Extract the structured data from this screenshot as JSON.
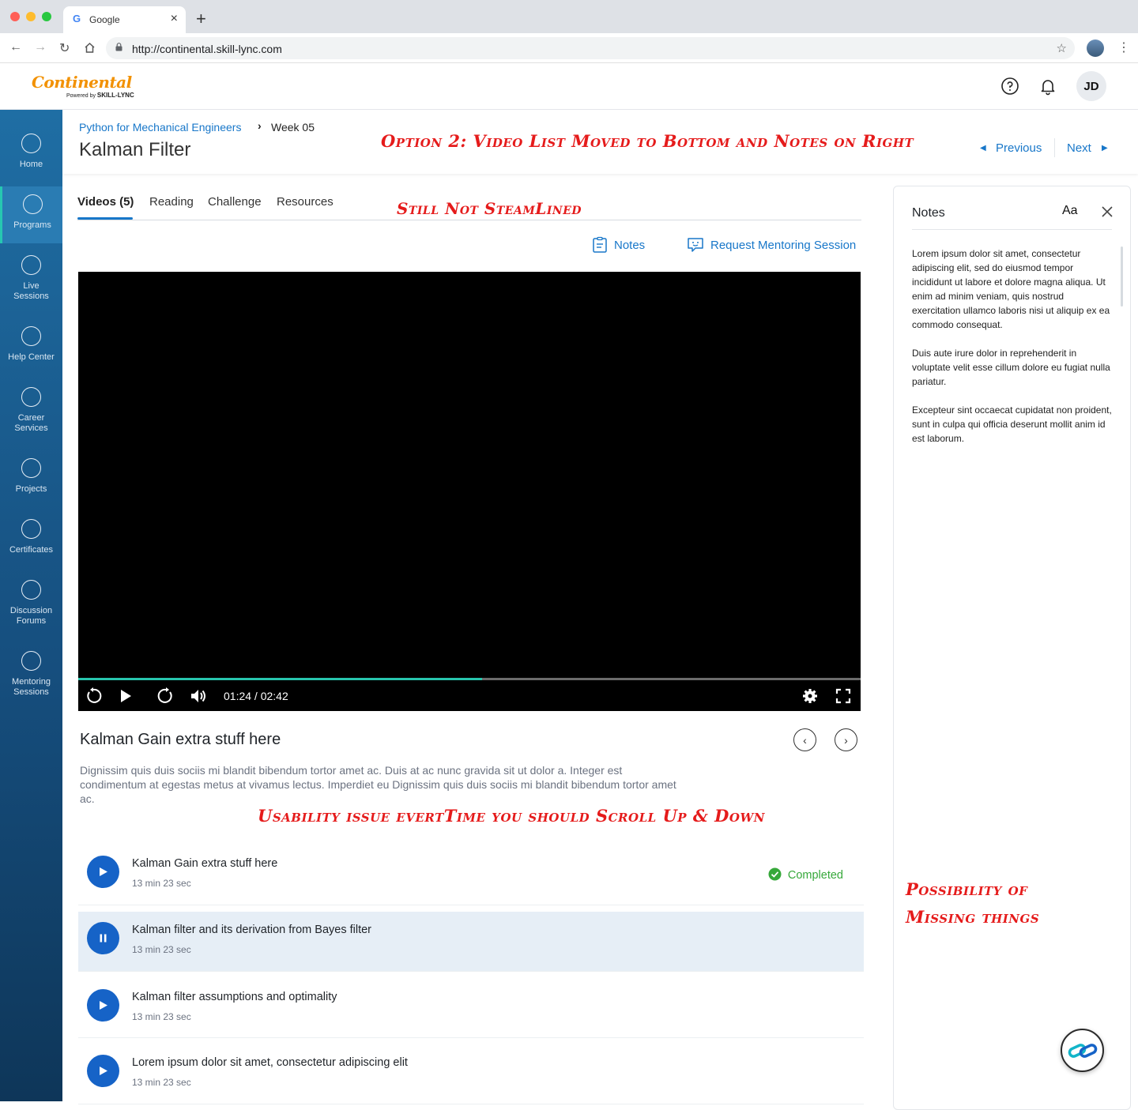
{
  "browser": {
    "tab_title": "Google",
    "url": "http://continental.skill-lync.com",
    "traffic_colors": [
      "#ff5f57",
      "#febc2e",
      "#28c840"
    ]
  },
  "header": {
    "logo_text": "Continental",
    "logo_sub_prefix": "Powered by ",
    "logo_sub_brand": "SKILL-LYNC",
    "avatar_initials": "JD",
    "icons": [
      "help-icon",
      "bell-icon"
    ]
  },
  "sidebar": {
    "items": [
      {
        "label": "Home"
      },
      {
        "label": "Programs"
      },
      {
        "label": "Live Sessions"
      },
      {
        "label": "Help Center"
      },
      {
        "label": "Career Services"
      },
      {
        "label": "Projects"
      },
      {
        "label": "Certificates"
      },
      {
        "label": "Discussion Forums"
      },
      {
        "label": "Mentoring Sessions"
      }
    ],
    "active": "Programs"
  },
  "breadcrumb": {
    "course": "Python for Mechanical Engineers",
    "separator": "›",
    "current": "Week 05"
  },
  "page_title": "Kalman Filter",
  "annotations": {
    "a1": "Option 2: Video List Moved to Bottom and Notes on Right",
    "a2": "Still Not SteamLined",
    "a3": "Usability issue evertTime you should Scroll Up & Down",
    "a4": "Possibility of",
    "a5": "Missing things"
  },
  "pager": {
    "previous": "Previous",
    "next": "Next"
  },
  "tabs": [
    {
      "label": "Videos (5)"
    },
    {
      "label": "Reading"
    },
    {
      "label": "Challenge"
    },
    {
      "label": "Resources"
    }
  ],
  "actions": {
    "notes": "Notes",
    "mentoring": "Request Mentoring Session"
  },
  "player": {
    "time": "01:24 / 02:42",
    "progress": 0.516,
    "accent": "#27c5ad"
  },
  "current_video": {
    "title": "Kalman Gain extra stuff here",
    "description": "Dignissim quis duis sociis mi blandit bibendum tortor amet ac. Duis at ac nunc gravida sit ut dolor a. Integer est condimentum at egestas metus at vivamus lectus. Imperdiet eu Dignissim quis duis sociis mi blandit bibendum tortor amet ac."
  },
  "video_list": [
    {
      "title": "Kalman Gain extra stuff here",
      "duration": "13 min 23 sec",
      "status": "Completed",
      "state": "play"
    },
    {
      "title": "Kalman filter and its derivation from Bayes filter",
      "duration": "13 min 23 sec",
      "status": "",
      "state": "pause"
    },
    {
      "title": "Kalman filter assumptions and optimality",
      "duration": "13 min 23 sec",
      "status": "",
      "state": "play"
    },
    {
      "title": "Lorem ipsum dolor sit amet, consectetur adipiscing elit",
      "duration": "13 min 23 sec",
      "status": "",
      "state": "play"
    }
  ],
  "notes_panel": {
    "title": "Notes",
    "font_button": "Aa",
    "paragraphs": [
      "Lorem ipsum dolor sit amet, consectetur adipiscing elit, sed do eiusmod tempor incididunt ut labore et dolore magna aliqua. Ut enim ad minim veniam, quis nostrud exercitation ullamco laboris nisi ut aliquip ex ea commodo consequat.",
      "Duis aute irure dolor in reprehenderit in voluptate velit esse cillum dolore eu fugiat nulla pariatur.",
      "Excepteur sint occaecat cupidatat non proident, sunt in culpa qui officia deserunt mollit anim id est laborum."
    ]
  },
  "colors": {
    "brand": "#f29100",
    "link": "#1877c9",
    "completed": "#36a83a",
    "play_button": "#1663c7",
    "annotation": "#e51b1b"
  }
}
